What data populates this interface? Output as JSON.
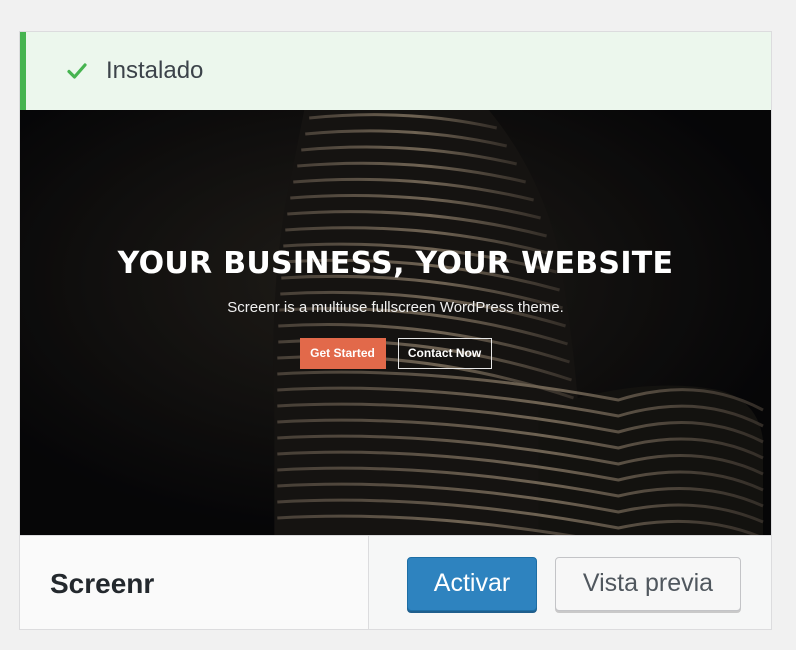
{
  "notice": {
    "icon": "checkmark-icon",
    "text": "Instalado",
    "accent": "#46b450"
  },
  "theme_screenshot": {
    "headline": "YOUR BUSINESS, YOUR WEBSITE",
    "subtitle": "Screenr is a multiuse fullscreen WordPress theme.",
    "primary_button": "Get Started",
    "secondary_button": "Contact Now",
    "primary_color": "#e2694a"
  },
  "footer": {
    "theme_name": "Screenr",
    "activate_label": "Activar",
    "preview_label": "Vista previa",
    "activate_color": "#2e83bf"
  }
}
